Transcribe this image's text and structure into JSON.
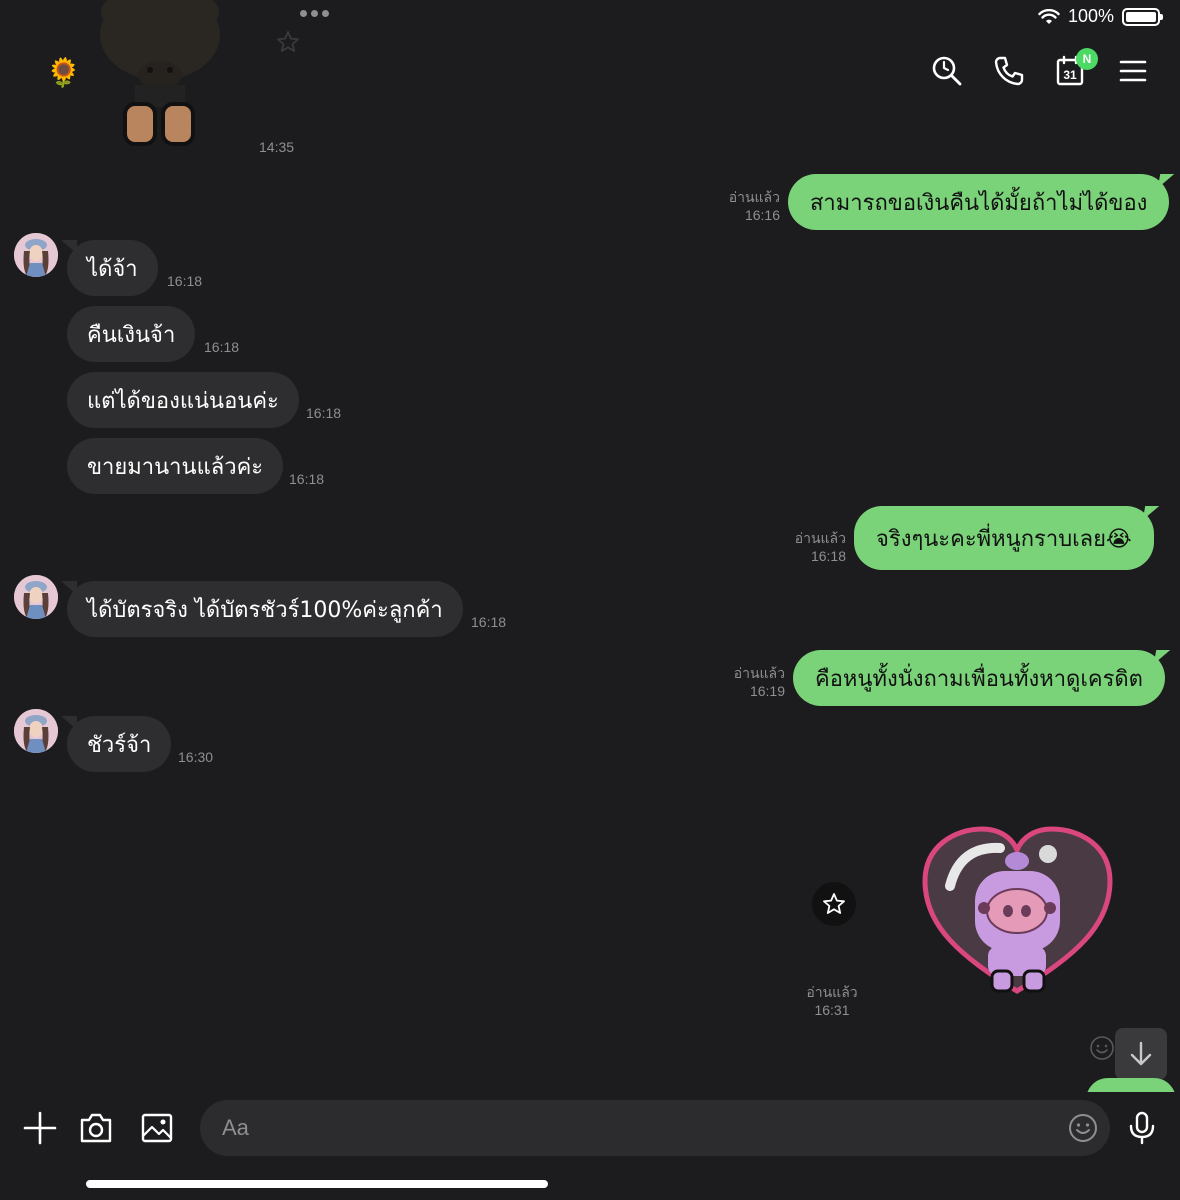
{
  "status": {
    "battery": "100%"
  },
  "header": {
    "title_emoji": "🌻",
    "calendar_day": "31",
    "calendar_badge": "N"
  },
  "top_sticker_time": "14:35",
  "messages": [
    {
      "dir": "out",
      "text": "สามารถขอเงินคืนได้มั้ยถ้าไม่ได้ของ",
      "read": "อ่านแล้ว",
      "time": "16:16"
    },
    {
      "dir": "in",
      "text": "ได้จ้า",
      "time": "16:18"
    },
    {
      "dir": "in",
      "text": "คืนเงินจ้า",
      "time": "16:18"
    },
    {
      "dir": "in",
      "text": "แต่ได้ของแน่นอนค่ะ",
      "time": "16:18"
    },
    {
      "dir": "in",
      "text": "ขายมานานแล้วค่ะ",
      "time": "16:18"
    },
    {
      "dir": "out",
      "text": "จริงๆนะคะพี่หนูกราบเลย😭",
      "read": "อ่านแล้ว",
      "time": "16:18"
    },
    {
      "dir": "in",
      "text": "ได้บัตรจริง ได้บัตรชัวร์100%ค่ะลูกค้า",
      "time": "16:18"
    },
    {
      "dir": "out",
      "text": "คือหนูทั้งนั่งถามเพื่อนทั้งหาดูเครดิต",
      "read": "อ่านแล้ว",
      "time": "16:19"
    },
    {
      "dir": "in",
      "text": "ชัวร์จ้า",
      "time": "16:30"
    }
  ],
  "sticker_out": {
    "read": "อ่านแล้ว",
    "time": "16:31"
  },
  "composer": {
    "placeholder": "Aa"
  },
  "colors": {
    "bg": "#1c1c1e",
    "out_bubble": "#7ad279",
    "in_bubble": "#2e2e30",
    "badge": "#4cd964"
  }
}
